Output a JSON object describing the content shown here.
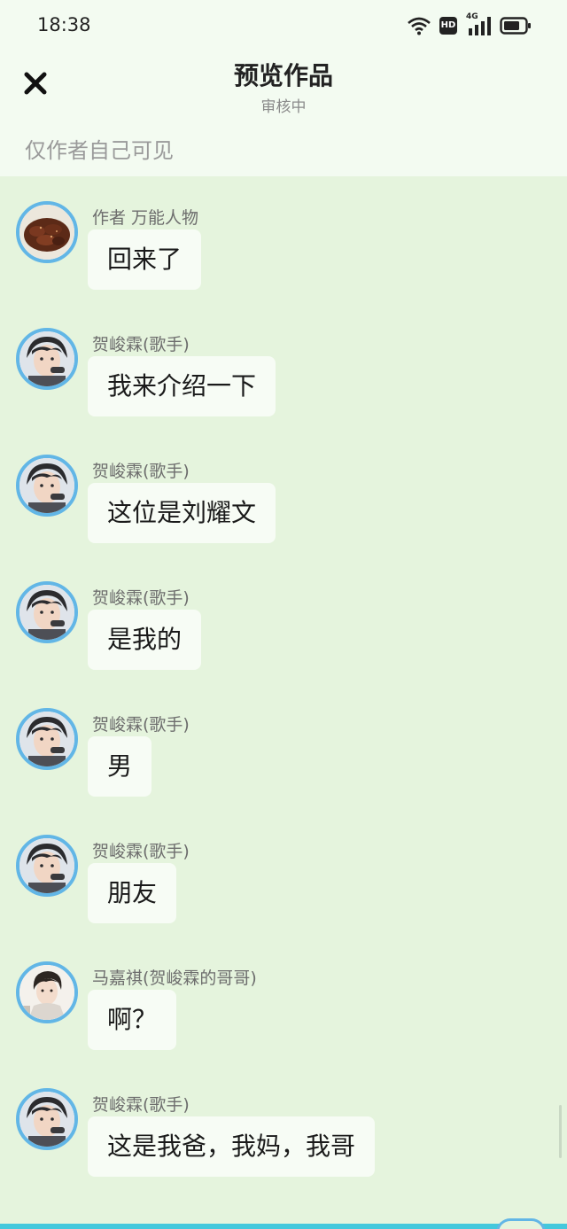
{
  "status_bar": {
    "time": "18:38",
    "hd_label": "HD",
    "network_label": "4G",
    "icons": [
      "wifi-icon",
      "hd-icon",
      "signal-icon",
      "battery-icon"
    ]
  },
  "header": {
    "title": "预览作品",
    "subtitle": "审核中",
    "close_icon": "close-icon"
  },
  "visibility_note": "仅作者自己可见",
  "colors": {
    "background": "#e5f4dd",
    "header_background": "#f3fbf1",
    "bubble": "#f7fcf5",
    "avatar_ring": "#62b6e6",
    "bottom_accent": "#44c8dc"
  },
  "messages": [
    {
      "sender": "作者 万能人物",
      "text": "回来了",
      "avatar": "food-avatar"
    },
    {
      "sender": "贺峻霖(歌手)",
      "text": "我来介绍一下",
      "avatar": "singer-avatar"
    },
    {
      "sender": "贺峻霖(歌手)",
      "text": "这位是刘耀文",
      "avatar": "singer-avatar"
    },
    {
      "sender": "贺峻霖(歌手)",
      "text": "是我的",
      "avatar": "singer-avatar"
    },
    {
      "sender": "贺峻霖(歌手)",
      "text": "男",
      "avatar": "singer-avatar"
    },
    {
      "sender": "贺峻霖(歌手)",
      "text": "朋友",
      "avatar": "singer-avatar"
    },
    {
      "sender": "马嘉祺(贺峻霖的哥哥)",
      "text": "啊？",
      "avatar": "brother-avatar"
    },
    {
      "sender": "贺峻霖(歌手)",
      "text": "这是我爸，我妈，我哥",
      "avatar": "singer-avatar"
    }
  ]
}
